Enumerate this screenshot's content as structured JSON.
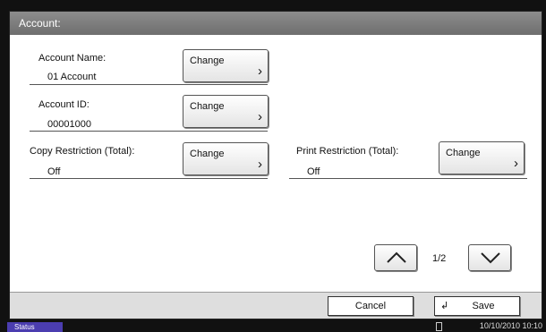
{
  "window": {
    "title": "Account:"
  },
  "fields": {
    "account_name": {
      "label": "Account Name:",
      "value": "01 Account",
      "button": "Change"
    },
    "account_id": {
      "label": "Account ID:",
      "value": "00001000",
      "button": "Change"
    },
    "copy_restriction": {
      "label": "Copy Restriction (Total):",
      "value": "Off",
      "button": "Change"
    },
    "print_restriction": {
      "label": "Print Restriction (Total):",
      "value": "Off",
      "button": "Change"
    }
  },
  "pagination": {
    "indicator": "1/2",
    "up_icon": "chevron-up-icon",
    "down_icon": "chevron-down-icon"
  },
  "footer": {
    "cancel_label": "Cancel",
    "save_label": "Save",
    "save_icon": "enter-return-icon"
  },
  "status_bar": {
    "status_label": "Status",
    "datetime": "10/10/2010  10:10"
  }
}
